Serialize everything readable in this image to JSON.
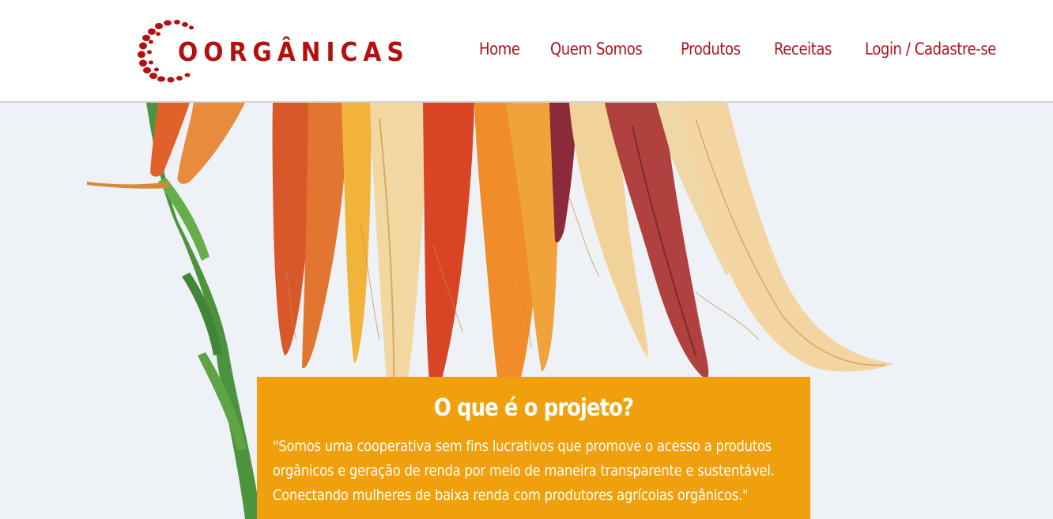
{
  "brand": {
    "name": "OORGÂNICAS",
    "colors": {
      "primary": "#b3100f",
      "accent": "#f0a00c",
      "nav": "#a8141b",
      "hero_bg": "#eef1f5"
    }
  },
  "nav": {
    "items": [
      {
        "id": "home",
        "label": "Home"
      },
      {
        "id": "quem-somos",
        "label": "Quem Somos"
      },
      {
        "id": "produtos",
        "label": "Produtos"
      },
      {
        "id": "receitas",
        "label": "Receitas"
      },
      {
        "id": "login",
        "label": "Login / Cadastre-se"
      }
    ]
  },
  "hero": {
    "image": "carrots-photo"
  },
  "about": {
    "title": "O que é o projeto?",
    "text": "\"Somos uma cooperativa sem fins lucrativos que promove o acesso a produtos orgânicos e geração de renda por meio de maneira transparente e sustentável. Conectando mulheres de baixa renda com produtores agrícolas orgânicos.\""
  }
}
